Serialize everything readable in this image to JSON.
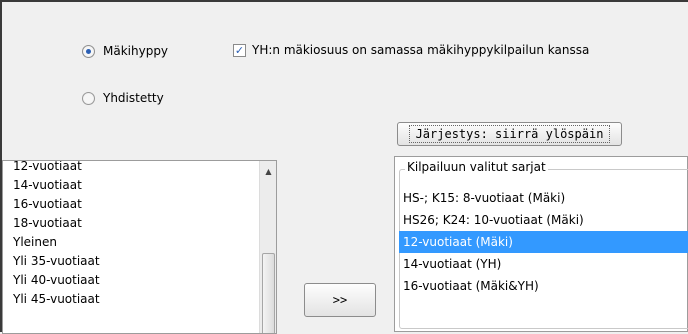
{
  "sport_type": {
    "options": [
      {
        "label": "Mäkihyppy",
        "checked": true
      },
      {
        "label": "Yhdistetty",
        "checked": false
      }
    ]
  },
  "combined_checkbox": {
    "label": "YH:n mäkiosuus on samassa mäkihyppykilpailun kanssa",
    "checked": true
  },
  "sort_button": {
    "label": "Järjestys: siirrä ylöspäin"
  },
  "move_button": {
    "label": ">>"
  },
  "available_list": {
    "items": [
      "12-vuotiaat",
      "14-vuotiaat",
      "16-vuotiaat",
      "18-vuotiaat",
      "Yleinen",
      "Yli 35-vuotiaat",
      "Yli 40-vuotiaat",
      "Yli 45-vuotiaat"
    ]
  },
  "selected_group": {
    "title": "Kilpailuun valitut sarjat",
    "items": [
      "HS-; K15: 8-vuotiaat (Mäki)",
      "HS26; K24: 10-vuotiaat (Mäki)",
      "12-vuotiaat (Mäki)",
      "14-vuotiaat (YH)",
      "16-vuotiaat (Mäki&YH)"
    ],
    "selected_index": 2
  },
  "colors": {
    "selection": "#3399ff",
    "window_bg": "#f0f0f0",
    "check_accent": "#2b5fb4"
  }
}
